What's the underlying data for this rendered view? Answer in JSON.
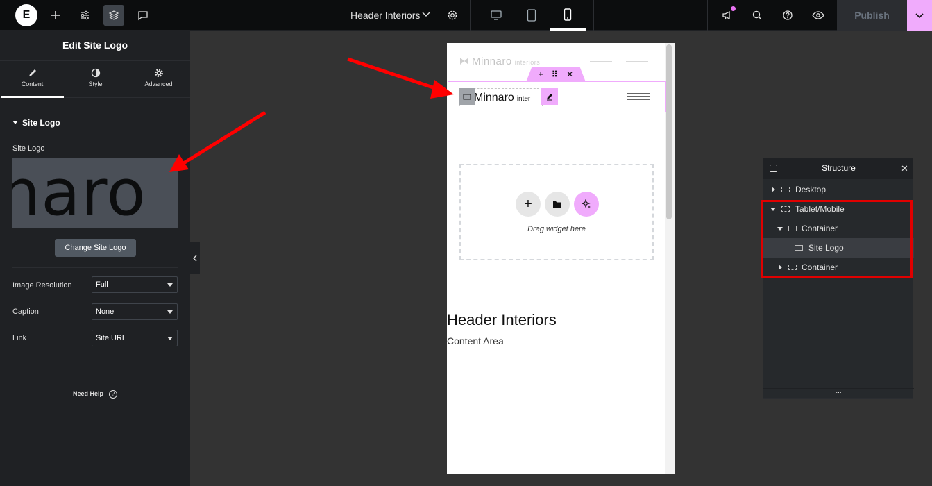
{
  "topbar": {
    "document_title": "Header Interiors",
    "publish_label": "Publish",
    "logo_letter": "E",
    "icons": [
      "elementor-logo-icon",
      "plus-icon",
      "sliders-icon",
      "layers-icon",
      "comment-icon",
      "chevron-down-icon",
      "gear-icon",
      "desktop-icon",
      "tablet-icon",
      "mobile-icon",
      "megaphone-icon",
      "search-icon",
      "help-icon",
      "eye-icon"
    ],
    "active_device": "mobile",
    "accent_color": "#f0abfc"
  },
  "panel": {
    "title": "Edit Site Logo",
    "tabs": [
      {
        "label": "Content",
        "icon": "pencil-icon",
        "active": true
      },
      {
        "label": "Style",
        "icon": "contrast-icon",
        "active": false
      },
      {
        "label": "Advanced",
        "icon": "gear-icon",
        "active": false
      }
    ],
    "section_title": "Site Logo",
    "site_logo_label": "Site Logo",
    "logo_preview_text": "naro",
    "change_button": "Change Site Logo",
    "fields": [
      {
        "label": "Image Resolution",
        "value": "Full"
      },
      {
        "label": "Caption",
        "value": "None"
      },
      {
        "label": "Link",
        "value": "Site URL"
      }
    ],
    "help_label": "Need Help"
  },
  "preview": {
    "faint_logo": "Minnaro",
    "faint_logo_sub": "interiors",
    "logo_text": "Minnaro",
    "logo_sub": "inter",
    "drop_text": "Drag widget here",
    "heading": "Header Interiors",
    "content": "Content Area"
  },
  "structure": {
    "title": "Structure",
    "items": [
      {
        "label": "Desktop",
        "level": 0,
        "expanded": false
      },
      {
        "label": "Tablet/Mobile",
        "level": 0,
        "expanded": true
      },
      {
        "label": "Container",
        "level": 1,
        "expanded": true
      },
      {
        "label": "Site Logo",
        "level": 2,
        "selected": true
      },
      {
        "label": "Container",
        "level": 1,
        "expanded": false
      }
    ],
    "footer": "..."
  }
}
